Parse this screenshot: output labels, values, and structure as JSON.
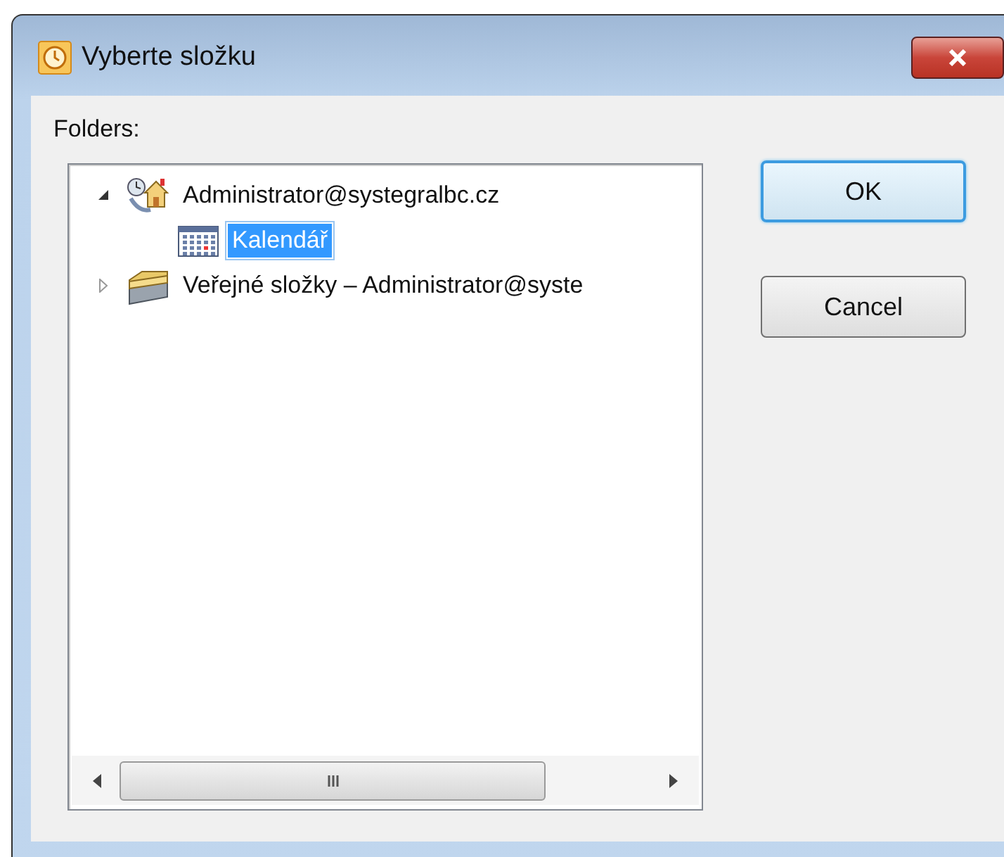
{
  "window": {
    "title": "Vyberte složku"
  },
  "folders_label": "Folders:",
  "tree": [
    {
      "label": "Administrator@systegralbc.cz",
      "kind": "mailbox",
      "expanded": true,
      "selected": false,
      "children": [
        {
          "label": "Kalendář",
          "kind": "calendar",
          "selected": true
        }
      ]
    },
    {
      "label": "Veřejné složky – Administrator@syste",
      "kind": "public",
      "expanded": false,
      "selected": false
    }
  ],
  "buttons": [
    {
      "label": "OK",
      "default": true
    },
    {
      "label": "Cancel",
      "default": false
    }
  ]
}
